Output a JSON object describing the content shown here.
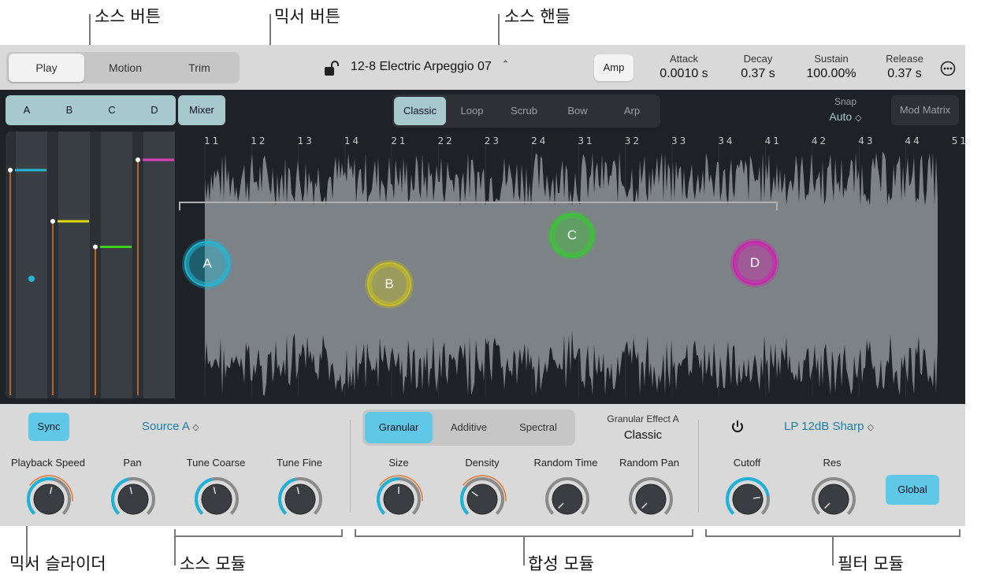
{
  "callouts": {
    "source_buttons": "소스 버튼",
    "mixer_button": "믹서 버튼",
    "source_handles": "소스 핸들",
    "mixer_sliders": "믹서 슬라이더",
    "source_module": "소스 모듈",
    "synth_module": "합성 모듈",
    "filter_module": "필터 모듈"
  },
  "header": {
    "tabs": [
      "Play",
      "Motion",
      "Trim"
    ],
    "active_tab": "Play",
    "preset_name": "12-8 Electric Arpeggio 07",
    "amp_label": "Amp",
    "envelope": [
      {
        "label": "Attack",
        "value": "0.0010 s"
      },
      {
        "label": "Decay",
        "value": "0.37 s"
      },
      {
        "label": "Sustain",
        "value": "100.00%"
      },
      {
        "label": "Release",
        "value": "0.37 s"
      }
    ]
  },
  "main": {
    "source_buttons": [
      "A",
      "B",
      "C",
      "D"
    ],
    "mixer_label": "Mixer",
    "play_modes": [
      "Classic",
      "Loop",
      "Scrub",
      "Bow",
      "Arp"
    ],
    "active_mode": "Classic",
    "snap_label": "Snap",
    "snap_value": "Auto",
    "mod_matrix_label": "Mod Matrix",
    "timeline_ticks": [
      "11",
      "12",
      "13",
      "14",
      "21",
      "22",
      "23",
      "24",
      "31",
      "32",
      "33",
      "34",
      "41",
      "42",
      "43",
      "44",
      "51"
    ],
    "handles": [
      {
        "label": "A",
        "color": "#1fb8d8"
      },
      {
        "label": "B",
        "color": "#c8c020"
      },
      {
        "label": "C",
        "color": "#36c830"
      },
      {
        "label": "D",
        "color": "#d020b0"
      }
    ],
    "mixer_colors": [
      "#1fb8d8",
      "#e0d810",
      "#40d020",
      "#e040c0"
    ],
    "mixer_levels": [
      0.88,
      0.68,
      0.58,
      0.92
    ]
  },
  "source_module": {
    "sync_label": "Sync",
    "source_select": "Source A",
    "knobs": [
      "Playback Speed",
      "Pan",
      "Tune Coarse",
      "Tune Fine"
    ]
  },
  "synth_module": {
    "modes": [
      "Granular",
      "Additive",
      "Spectral"
    ],
    "active_mode": "Granular",
    "effect_title": "Granular Effect A",
    "effect_value": "Classic",
    "knobs": [
      "Size",
      "Density",
      "Random Time",
      "Random Pan"
    ]
  },
  "filter_module": {
    "filter_type": "LP 12dB Sharp",
    "knobs": [
      "Cutoff",
      "Res"
    ],
    "global_label": "Global"
  }
}
